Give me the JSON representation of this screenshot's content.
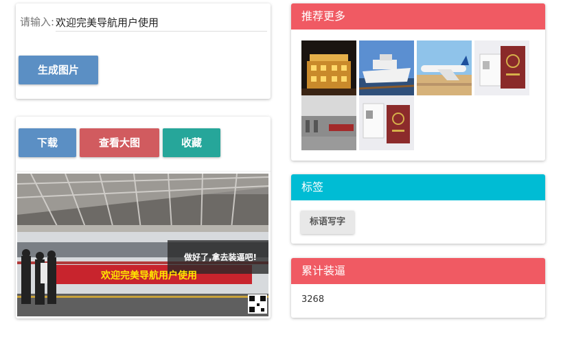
{
  "generator": {
    "input_label": "请输入:",
    "input_value": "欢迎完美导航用户使用",
    "generate_button": "生成图片"
  },
  "result": {
    "download_button": "下载",
    "view_large_button": "查看大图",
    "favorite_button": "收藏",
    "overlay_caption": "做好了,拿去装逼吧!",
    "banner_text": "欢迎完美导航用户使用"
  },
  "recommend": {
    "title": "推荐更多",
    "header_color": "#f05a63"
  },
  "tags": {
    "title": "标签",
    "header_color": "#00bcd4",
    "items": [
      "标语写字"
    ]
  },
  "counter": {
    "title": "累计装逼",
    "header_color": "#f05a63",
    "value": "3268"
  },
  "colors": {
    "primary": "#5b8fc4",
    "danger": "#d9534f",
    "teal": "#26a69a"
  }
}
